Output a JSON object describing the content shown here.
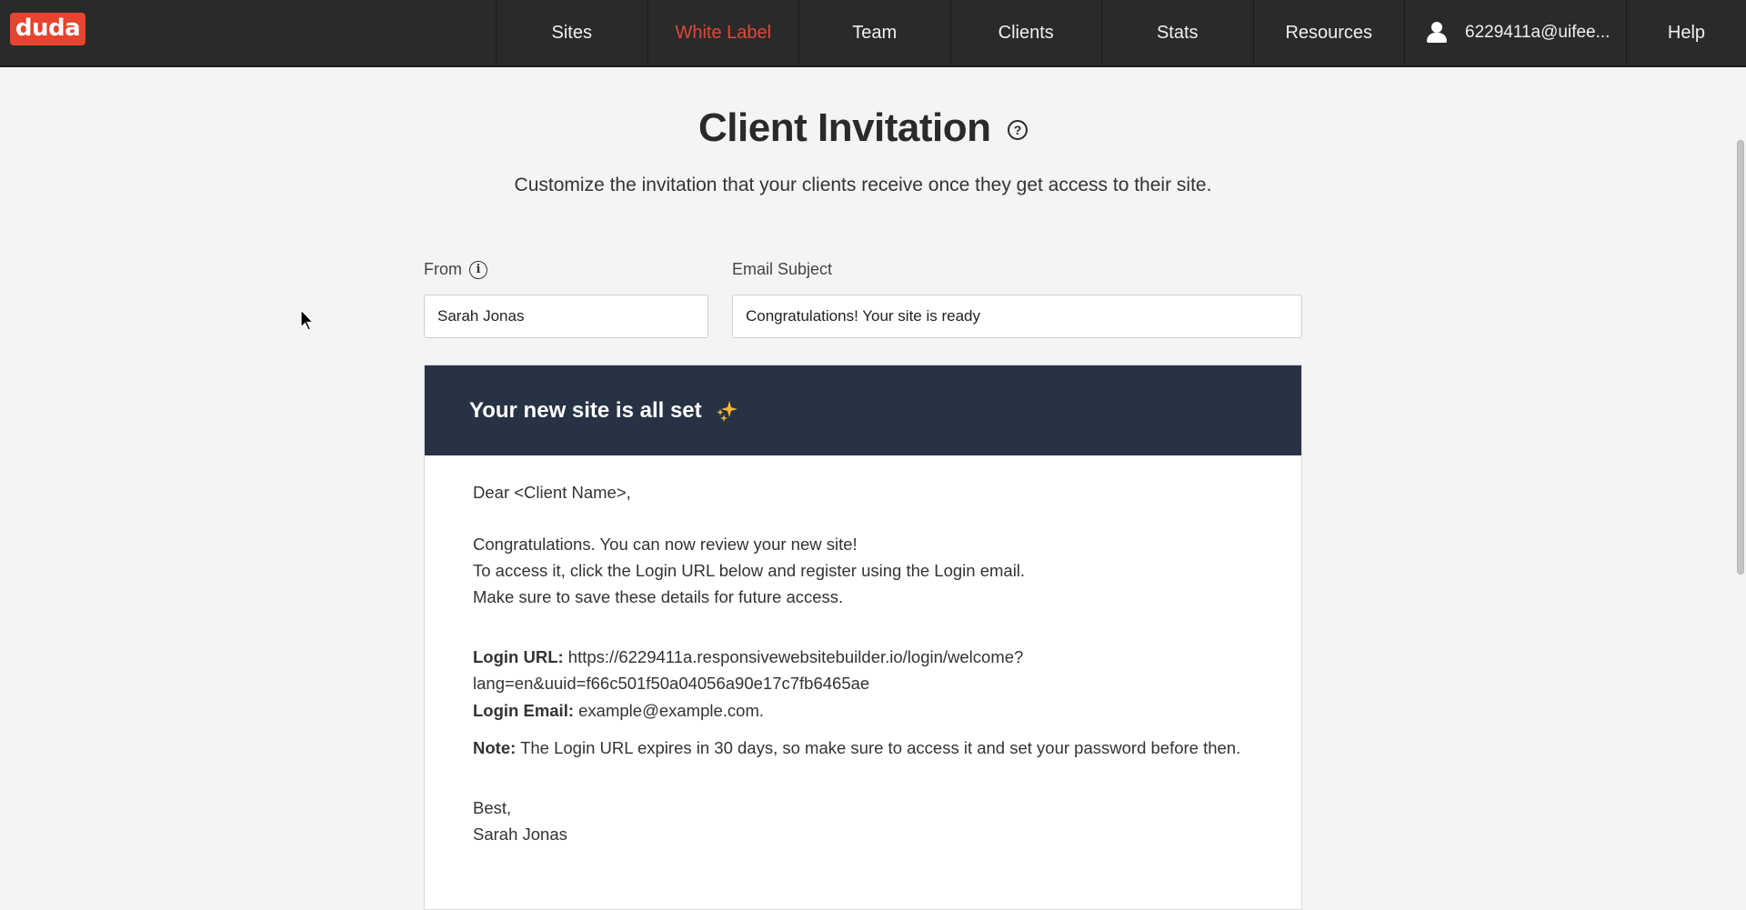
{
  "navbar": {
    "logo": "duda",
    "items": [
      {
        "label": "Sites",
        "active": false
      },
      {
        "label": "White Label",
        "active": true
      },
      {
        "label": "Team",
        "active": false
      },
      {
        "label": "Clients",
        "active": false
      },
      {
        "label": "Stats",
        "active": false
      },
      {
        "label": "Resources",
        "active": false
      }
    ],
    "user": {
      "icon": "user-icon",
      "label": "6229411a@uifee..."
    },
    "help": "Help",
    "active_color": "#e0483a"
  },
  "header": {
    "title": "Client Invitation",
    "help_icon": "question-circle-icon",
    "help_glyph": "?",
    "subtitle": "Customize the invitation that your clients receive once they get access to their site."
  },
  "form": {
    "from": {
      "label": "From",
      "info_icon": "info-circle-icon",
      "info_glyph": "i",
      "value": "Sarah Jonas"
    },
    "subject": {
      "label": "Email Subject",
      "value": "Congratulations! Your site is ready"
    }
  },
  "email": {
    "header_title": "Your new site is all set",
    "header_icon": "sparkles-icon",
    "header_bg": "#273244",
    "greeting": "Dear <Client Name>,",
    "lines": [
      "Congratulations. You can now review your new site!",
      "To access it, click the Login URL below and register using the Login email.",
      "Make sure to save these details for future access."
    ],
    "login_url_label": "Login URL:",
    "login_url_line1": " https://6229411a.responsivewebsitebuilder.io/login/welcome?",
    "login_url_line2": "lang=en&uuid=f66c501f50a04056a90e17c7fb6465ae",
    "login_email_label": "Login Email:",
    "login_email_value": " example@example.com.",
    "note_label": "Note:",
    "note_text": " The Login URL expires in 30 days, so make sure to access it and set your password before then.",
    "signoff": "Best,",
    "signature": "Sarah Jonas"
  }
}
